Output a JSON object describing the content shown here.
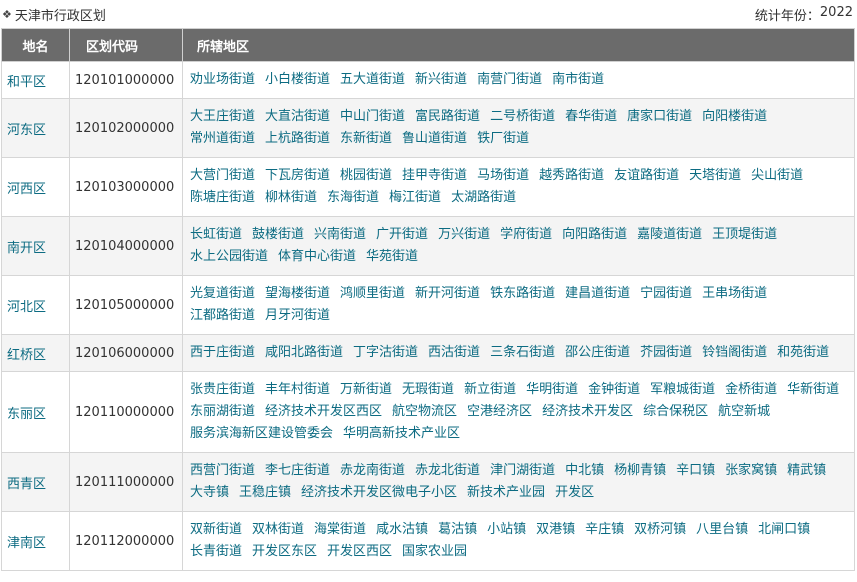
{
  "header": {
    "title": "天津市行政区划",
    "year_label": "统计年份：",
    "year_value": "2022"
  },
  "columns": [
    "地名",
    "区划代码",
    "所辖地区"
  ],
  "rows": [
    {
      "name": "和平区",
      "code": "120101000000",
      "subs": [
        "劝业场街道",
        "小白楼街道",
        "五大道街道",
        "新兴街道",
        "南营门街道",
        "南市街道"
      ]
    },
    {
      "name": "河东区",
      "code": "120102000000",
      "subs": [
        "大王庄街道",
        "大直沽街道",
        "中山门街道",
        "富民路街道",
        "二号桥街道",
        "春华街道",
        "唐家口街道",
        "向阳楼街道",
        "常州道街道",
        "上杭路街道",
        "东新街道",
        "鲁山道街道",
        "铁厂街道"
      ]
    },
    {
      "name": "河西区",
      "code": "120103000000",
      "subs": [
        "大营门街道",
        "下瓦房街道",
        "桃园街道",
        "挂甲寺街道",
        "马场街道",
        "越秀路街道",
        "友谊路街道",
        "天塔街道",
        "尖山街道",
        "陈塘庄街道",
        "柳林街道",
        "东海街道",
        "梅江街道",
        "太湖路街道"
      ]
    },
    {
      "name": "南开区",
      "code": "120104000000",
      "subs": [
        "长虹街道",
        "鼓楼街道",
        "兴南街道",
        "广开街道",
        "万兴街道",
        "学府街道",
        "向阳路街道",
        "嘉陵道街道",
        "王顶堤街道",
        "水上公园街道",
        "体育中心街道",
        "华苑街道"
      ]
    },
    {
      "name": "河北区",
      "code": "120105000000",
      "subs": [
        "光复道街道",
        "望海楼街道",
        "鸿顺里街道",
        "新开河街道",
        "铁东路街道",
        "建昌道街道",
        "宁园街道",
        "王串场街道",
        "江都路街道",
        "月牙河街道"
      ]
    },
    {
      "name": "红桥区",
      "code": "120106000000",
      "subs": [
        "西于庄街道",
        "咸阳北路街道",
        "丁字沽街道",
        "西沽街道",
        "三条石街道",
        "邵公庄街道",
        "芥园街道",
        "铃铛阁街道",
        "和苑街道"
      ]
    },
    {
      "name": "东丽区",
      "code": "120110000000",
      "subs": [
        "张贵庄街道",
        "丰年村街道",
        "万新街道",
        "无瑕街道",
        "新立街道",
        "华明街道",
        "金钟街道",
        "军粮城街道",
        "金桥街道",
        "华新街道",
        "东丽湖街道",
        "经济技术开发区西区",
        "航空物流区",
        "空港经济区",
        "经济技术开发区",
        "综合保税区",
        "航空新城",
        "服务滨海新区建设管委会",
        "华明高新技术产业区"
      ]
    },
    {
      "name": "西青区",
      "code": "120111000000",
      "subs": [
        "西营门街道",
        "李七庄街道",
        "赤龙南街道",
        "赤龙北街道",
        "津门湖街道",
        "中北镇",
        "杨柳青镇",
        "辛口镇",
        "张家窝镇",
        "精武镇",
        "大寺镇",
        "王稳庄镇",
        "经济技术开发区微电子小区",
        "新技术产业园",
        "开发区"
      ]
    },
    {
      "name": "津南区",
      "code": "120112000000",
      "subs": [
        "双新街道",
        "双林街道",
        "海棠街道",
        "咸水沽镇",
        "葛沽镇",
        "小站镇",
        "双港镇",
        "辛庄镇",
        "双桥河镇",
        "八里台镇",
        "北闸口镇",
        "长青街道",
        "开发区东区",
        "开发区西区",
        "国家农业园"
      ]
    }
  ]
}
